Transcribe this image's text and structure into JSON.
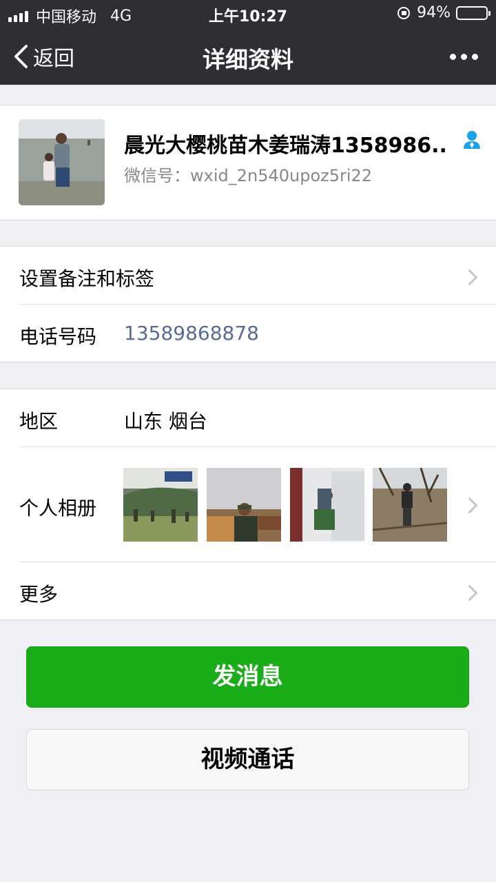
{
  "status_bar": {
    "carrier": "中国移动",
    "network": "4G",
    "time": "上午10:27",
    "battery": "94%",
    "battery_level": 0.94,
    "icons": [
      "signal-icon",
      "rotation-lock-icon",
      "battery-icon"
    ]
  },
  "nav": {
    "back_label": "返回",
    "title": "详细资料",
    "more_icon": "more-dots-icon"
  },
  "profile": {
    "name": "晨光大樱桃苗木姜瑞涛1358986...",
    "wechat_id": "微信号：wxid_2n540upoz5ri22",
    "avatar_icon": "avatar-photo",
    "gender_icon": "person-icon",
    "accent_color": "#1aa3e8"
  },
  "rows": {
    "remark_label": "设置备注和标签",
    "phone_label": "电话号码",
    "phone_value": "13589868878",
    "region_label": "地区",
    "region_value": "山东 烟台",
    "album_label": "个人相册",
    "more_label": "更多"
  },
  "album": {
    "photos": [
      "orchard-hillside-photo",
      "man-with-plants-photo",
      "man-holding-seedlings-photo",
      "man-in-orchard-photo"
    ]
  },
  "buttons": {
    "send_message": "发消息",
    "video_call": "视频通话"
  },
  "colors": {
    "nav_bg": "#2e2e33",
    "primary_green": "#1aad19",
    "link_blue": "#576b95",
    "page_bg": "#efeff4"
  }
}
